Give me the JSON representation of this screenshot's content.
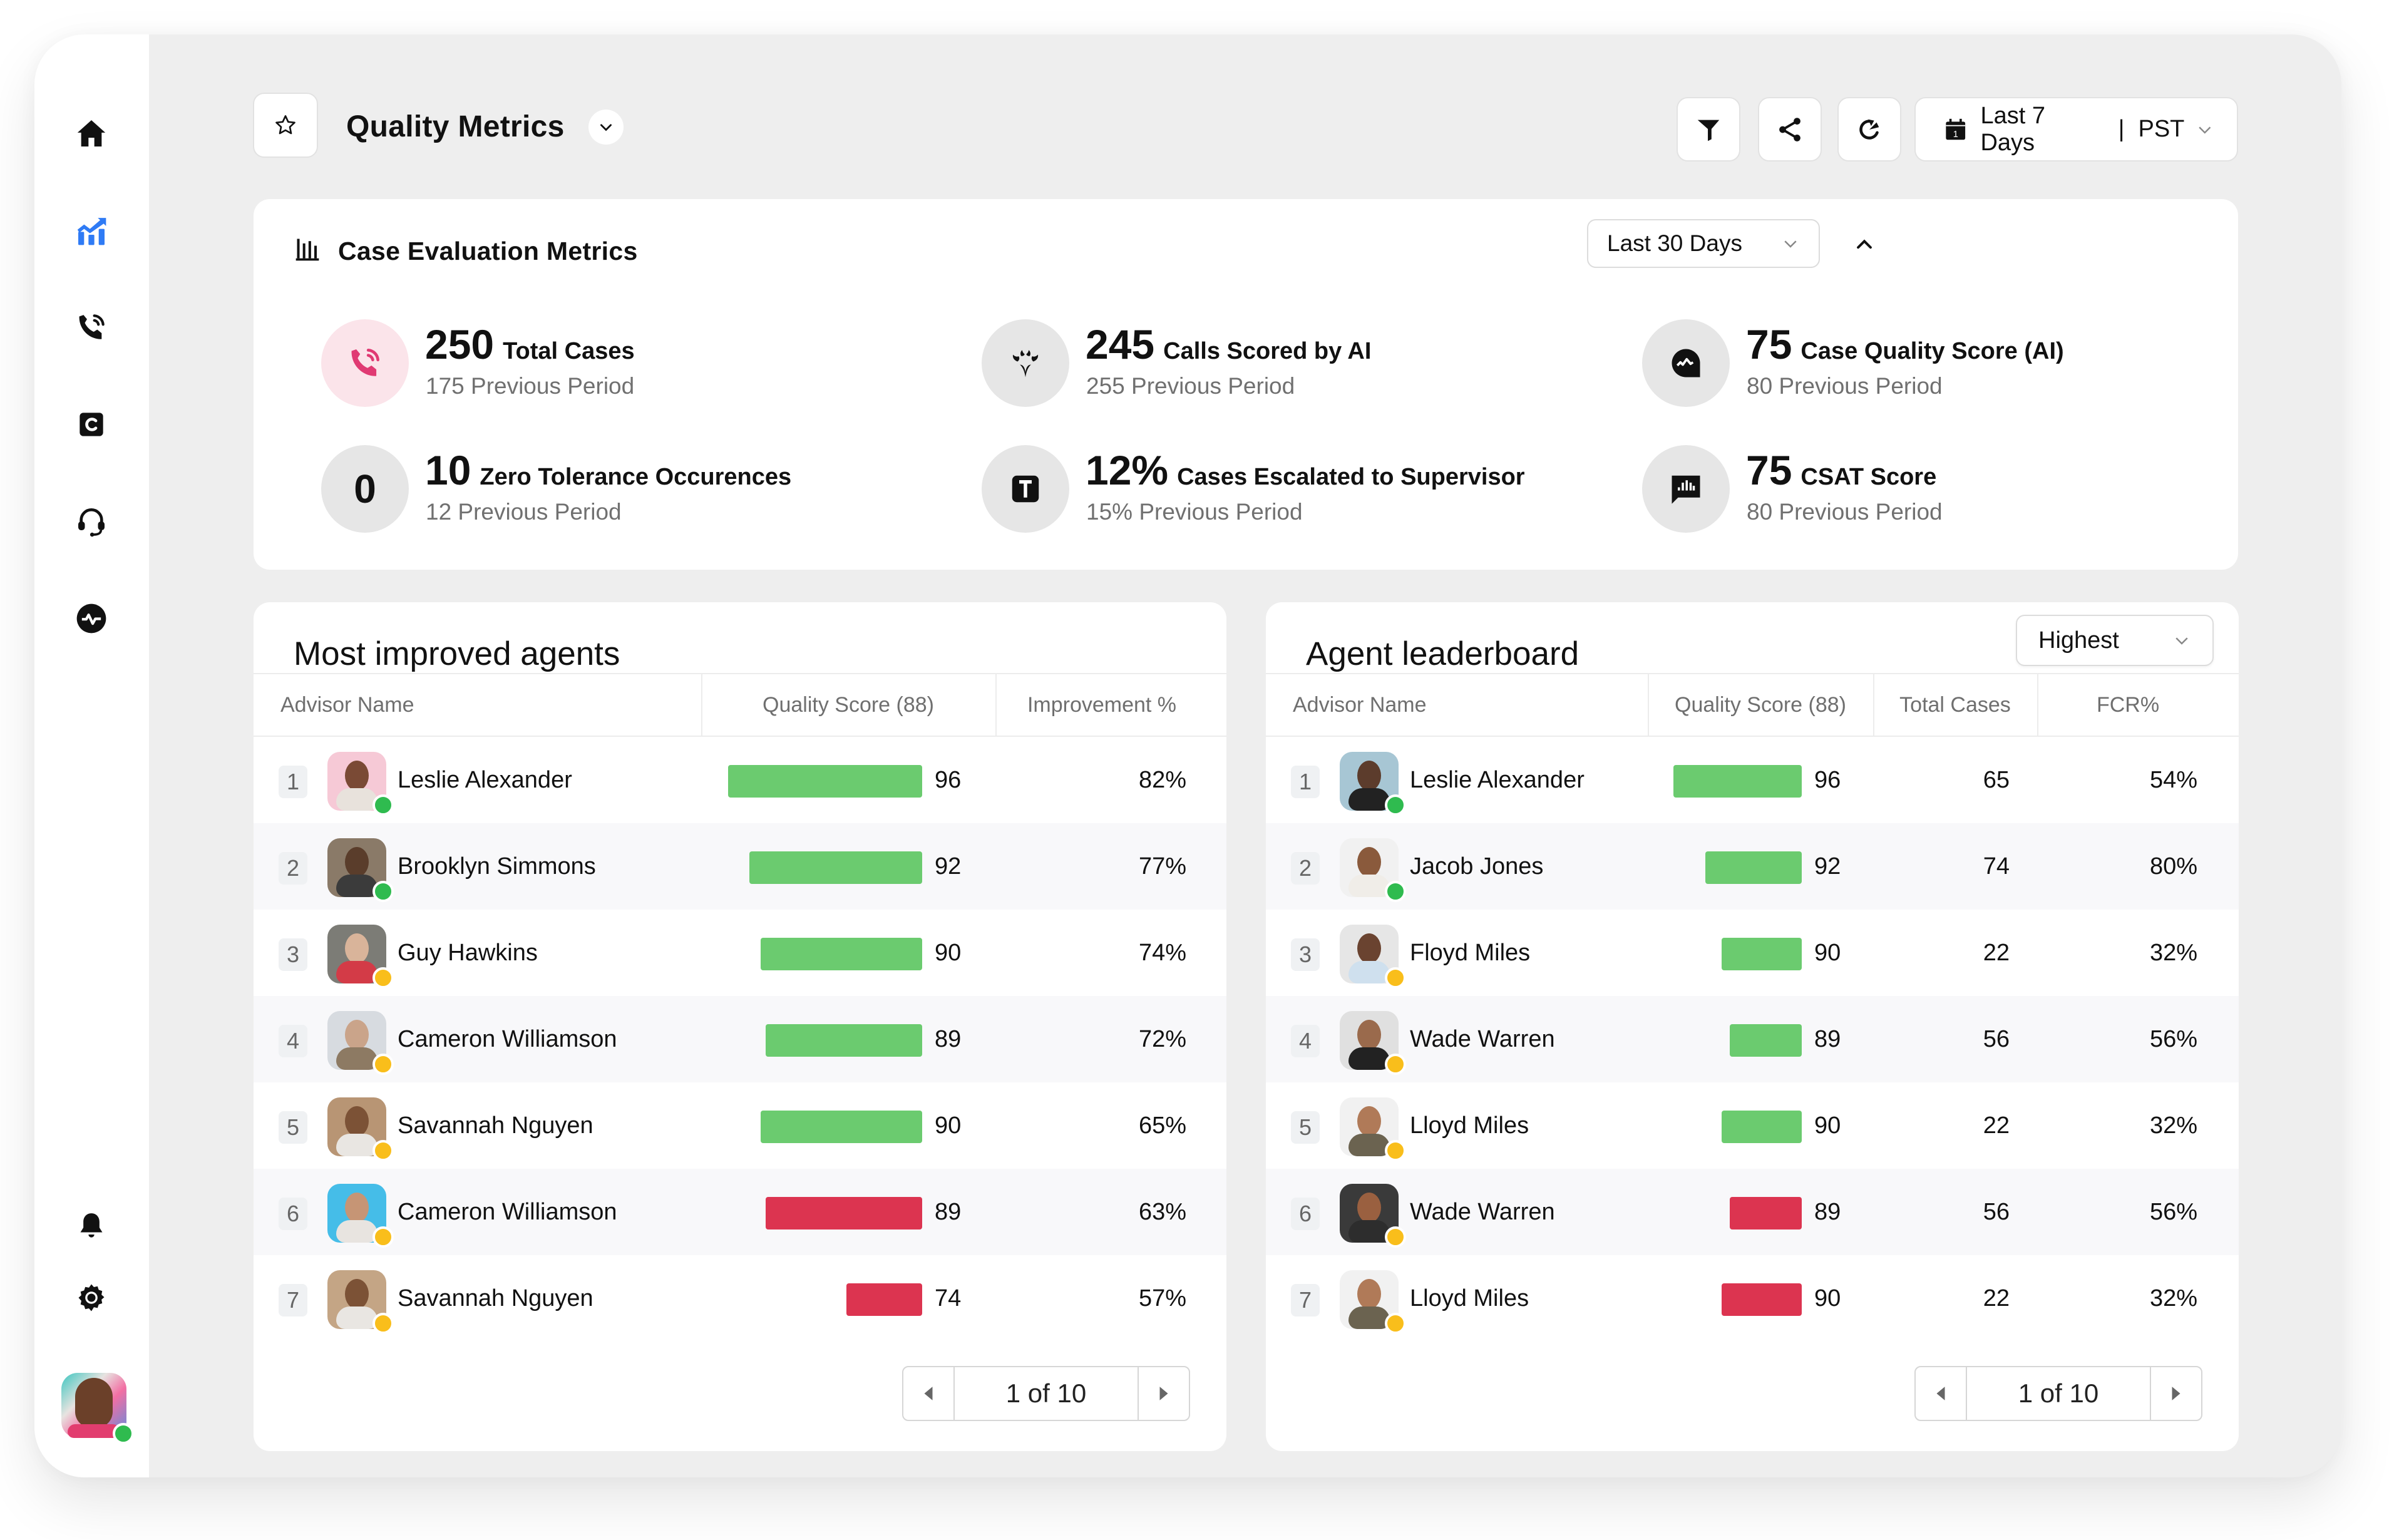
{
  "header": {
    "title": "Quality Metrics",
    "date_range": "Last 7 Days",
    "timezone": "PST",
    "separator": "|",
    "icons": [
      "star-icon",
      "chevron-down-icon",
      "filter-icon",
      "share-icon",
      "refresh-icon",
      "calendar-icon"
    ]
  },
  "sidebar": {
    "items": [
      {
        "id": "home",
        "icon": "home-icon",
        "active": false
      },
      {
        "id": "analytics",
        "icon": "analytics-chart-icon",
        "active": true
      },
      {
        "id": "calls",
        "icon": "phone-call-icon",
        "active": false
      },
      {
        "id": "cases",
        "icon": "case-c-icon",
        "active": false
      },
      {
        "id": "support",
        "icon": "headset-icon",
        "active": false
      },
      {
        "id": "activity",
        "icon": "pulse-icon",
        "active": false
      }
    ],
    "bottom": [
      {
        "id": "notifications",
        "icon": "bell-icon"
      },
      {
        "id": "settings",
        "icon": "gear-icon"
      }
    ],
    "user_status": "online"
  },
  "metrics": {
    "title": "Case Evaluation Metrics",
    "range": "Last 30 Days",
    "items": [
      {
        "value": "250",
        "label": "Total Cases",
        "previous": "175 Previous Period",
        "icon": "phone-call-icon"
      },
      {
        "value": "245",
        "label": "Calls Scored by AI",
        "previous": "255 Previous Period",
        "icon": "ai-sparkle-icon"
      },
      {
        "value": "75",
        "label": "Case Quality Score (AI)",
        "previous": "80 Previous Period",
        "icon": "quality-chat-icon"
      },
      {
        "value": "10",
        "label": "Zero Tolerance Occurences",
        "previous": "12 Previous Period",
        "icon": "zero-icon",
        "icon_text": "0"
      },
      {
        "value": "12%",
        "label": "Cases Escalated to Supervisor",
        "previous": "15% Previous Period",
        "icon": "escalation-t-icon"
      },
      {
        "value": "75",
        "label": "CSAT Score",
        "previous": "80 Previous Period",
        "icon": "csat-chat-icon"
      }
    ]
  },
  "colors": {
    "accent": "#2F7BF5",
    "bar_good": "#6BCB6F",
    "bar_bad": "#DC3450",
    "status_online": "#2FBB4F",
    "status_away": "#F9BE1B",
    "pink_icon": "#E03A73"
  },
  "improved": {
    "title": "Most improved agents",
    "columns": [
      "Advisor Name",
      "Quality Score (88)",
      "Improvement %"
    ],
    "rows": [
      {
        "rank": "1",
        "name": "Leslie Alexander",
        "score": 96,
        "score_label": "96",
        "improvement": "82%",
        "bar": "good",
        "status": "online"
      },
      {
        "rank": "2",
        "name": "Brooklyn Simmons",
        "score": 92,
        "score_label": "92",
        "improvement": "77%",
        "bar": "good",
        "status": "online"
      },
      {
        "rank": "3",
        "name": "Guy Hawkins",
        "score": 90,
        "score_label": "90",
        "improvement": "74%",
        "bar": "good",
        "status": "away"
      },
      {
        "rank": "4",
        "name": "Cameron Williamson",
        "score": 89,
        "score_label": "89",
        "improvement": "72%",
        "bar": "good",
        "status": "away"
      },
      {
        "rank": "5",
        "name": "Savannah Nguyen",
        "score": 90,
        "score_label": "90",
        "improvement": "65%",
        "bar": "good",
        "status": "away"
      },
      {
        "rank": "6",
        "name": "Cameron Williamson",
        "score": 89,
        "score_label": "89",
        "improvement": "63%",
        "bar": "bad",
        "status": "away"
      },
      {
        "rank": "7",
        "name": "Savannah Nguyen",
        "score": 74,
        "score_label": "74",
        "improvement": "57%",
        "bar": "bad",
        "status": "away"
      }
    ],
    "pagination": "1 of 10"
  },
  "leaderboard": {
    "title": "Agent leaderboard",
    "sort": "Highest",
    "columns": [
      "Advisor Name",
      "Quality Score (88)",
      "Total Cases",
      "FCR%"
    ],
    "rows": [
      {
        "rank": "1",
        "name": "Leslie Alexander",
        "score": 96,
        "score_label": "96",
        "cases": "65",
        "fcr": "54%",
        "bar": "good",
        "status": "online"
      },
      {
        "rank": "2",
        "name": "Jacob Jones",
        "score": 92,
        "score_label": "92",
        "cases": "74",
        "fcr": "80%",
        "bar": "good",
        "status": "online"
      },
      {
        "rank": "3",
        "name": "Floyd Miles",
        "score": 90,
        "score_label": "90",
        "cases": "22",
        "fcr": "32%",
        "bar": "good",
        "status": "away"
      },
      {
        "rank": "4",
        "name": "Wade Warren",
        "score": 89,
        "score_label": "89",
        "cases": "56",
        "fcr": "56%",
        "bar": "good",
        "status": "away"
      },
      {
        "rank": "5",
        "name": "Lloyd Miles",
        "score": 90,
        "score_label": "90",
        "cases": "22",
        "fcr": "32%",
        "bar": "good",
        "status": "away"
      },
      {
        "rank": "6",
        "name": "Wade Warren",
        "score": 89,
        "score_label": "89",
        "cases": "56",
        "fcr": "56%",
        "bar": "bad",
        "status": "away"
      },
      {
        "rank": "7",
        "name": "Lloyd Miles",
        "score": 90,
        "score_label": "90",
        "cases": "22",
        "fcr": "32%",
        "bar": "bad",
        "status": "away"
      }
    ],
    "pagination": "1 of 10"
  }
}
